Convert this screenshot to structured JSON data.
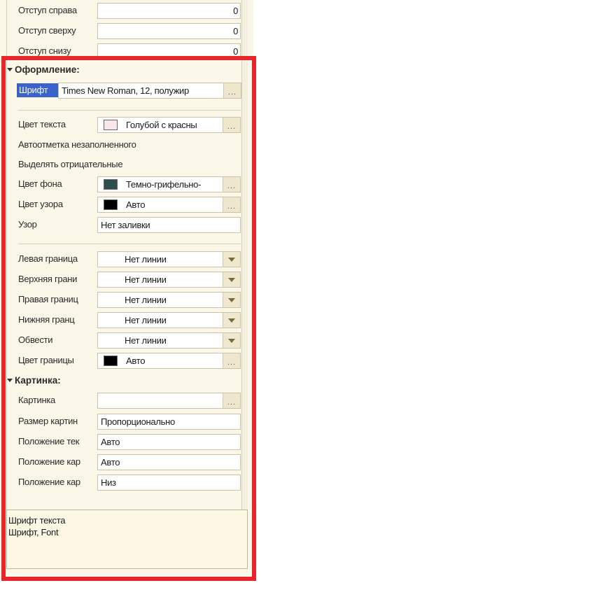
{
  "rows_top": [
    {
      "label": "Отступ справа",
      "value": "0"
    },
    {
      "label": "Отступ сверху",
      "value": "0"
    },
    {
      "label": "Отступ снизу",
      "value": "0"
    }
  ],
  "group_design": "Оформление:",
  "font_row": {
    "label": "Шрифт",
    "value": "Times New Roman, 12, полужир"
  },
  "text_color": {
    "label": "Цвет текста",
    "value": "Голубой с красны",
    "swatch": "#f7e6ea"
  },
  "autoflag_label": "Автоотметка незаполненного",
  "highlight_negative_label": "Выделять отрицательные",
  "bg_color": {
    "label": "Цвет фона",
    "value": "Темно-грифельно-",
    "swatch": "#2f4f4f"
  },
  "pattern_color": {
    "label": "Цвет узора",
    "value": "Авто",
    "swatch": "#000000"
  },
  "pattern": {
    "label": "Узор",
    "value": "Нет заливки"
  },
  "borders": [
    {
      "label": "Левая граница",
      "value": "Нет линии"
    },
    {
      "label": "Верхняя грани",
      "value": "Нет линии"
    },
    {
      "label": "Правая границ",
      "value": "Нет линии"
    },
    {
      "label": "Нижняя гранц",
      "value": "Нет линии"
    },
    {
      "label": "Обвести",
      "value": "Нет линии"
    }
  ],
  "border_color": {
    "label": "Цвет границы",
    "value": "Авто",
    "swatch": "#000000"
  },
  "group_picture": "Картинка:",
  "picture": {
    "label": "Картинка",
    "value": ""
  },
  "picture_rows": [
    {
      "label": "Размер картин",
      "value": "Пропорционально"
    },
    {
      "label": "Положение тек",
      "value": "Авто"
    },
    {
      "label": "Положение кар",
      "value": "Авто"
    },
    {
      "label": "Положение кар",
      "value": "Низ"
    }
  ],
  "description": {
    "line1": "Шрифт текста",
    "line2": "Шрифт, Font"
  },
  "ellipsis": "...",
  "accent": "#e8262a"
}
